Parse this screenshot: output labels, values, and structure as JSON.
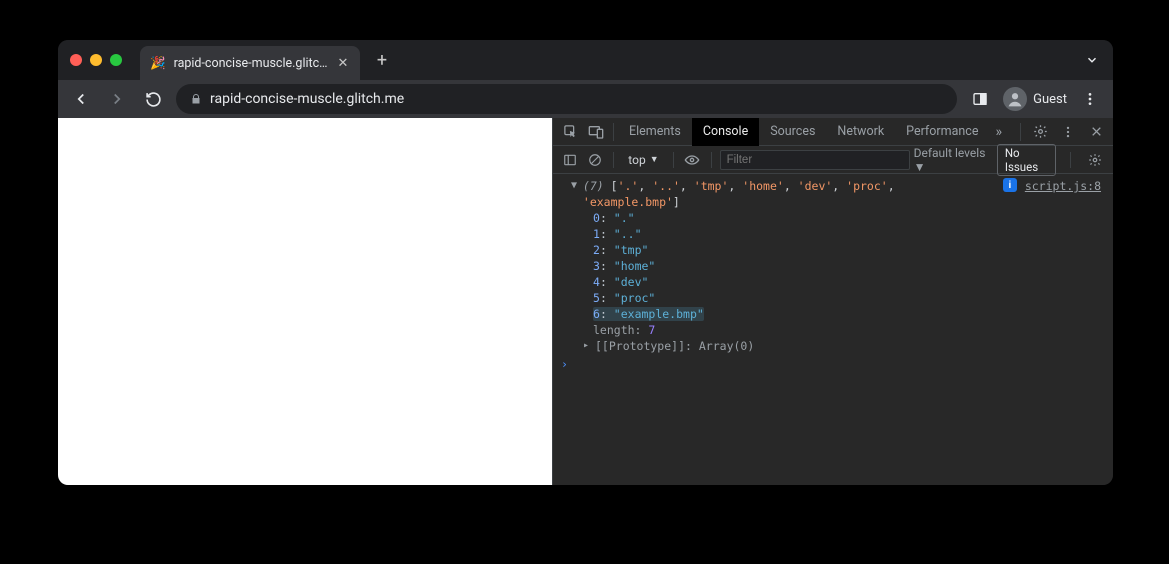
{
  "tab": {
    "title": "rapid-concise-muscle.glitch.me",
    "favicon": "🎉"
  },
  "url": "rapid-concise-muscle.glitch.me",
  "user": "Guest",
  "devtools": {
    "tabs": [
      "Elements",
      "Console",
      "Sources",
      "Network",
      "Performance"
    ],
    "active_index": 1,
    "context": "top",
    "filter_placeholder": "Filter",
    "levels": "Default levels",
    "issues": "No Issues",
    "source_link": "script.js:8",
    "array_length": 7,
    "array_items": [
      ".",
      "..",
      "tmp",
      "home",
      "dev",
      "proc",
      "example.bmp"
    ],
    "highlighted_index": 6,
    "proto": "[[Prototype]]",
    "proto_val": "Array(0)",
    "length_label": "length"
  }
}
